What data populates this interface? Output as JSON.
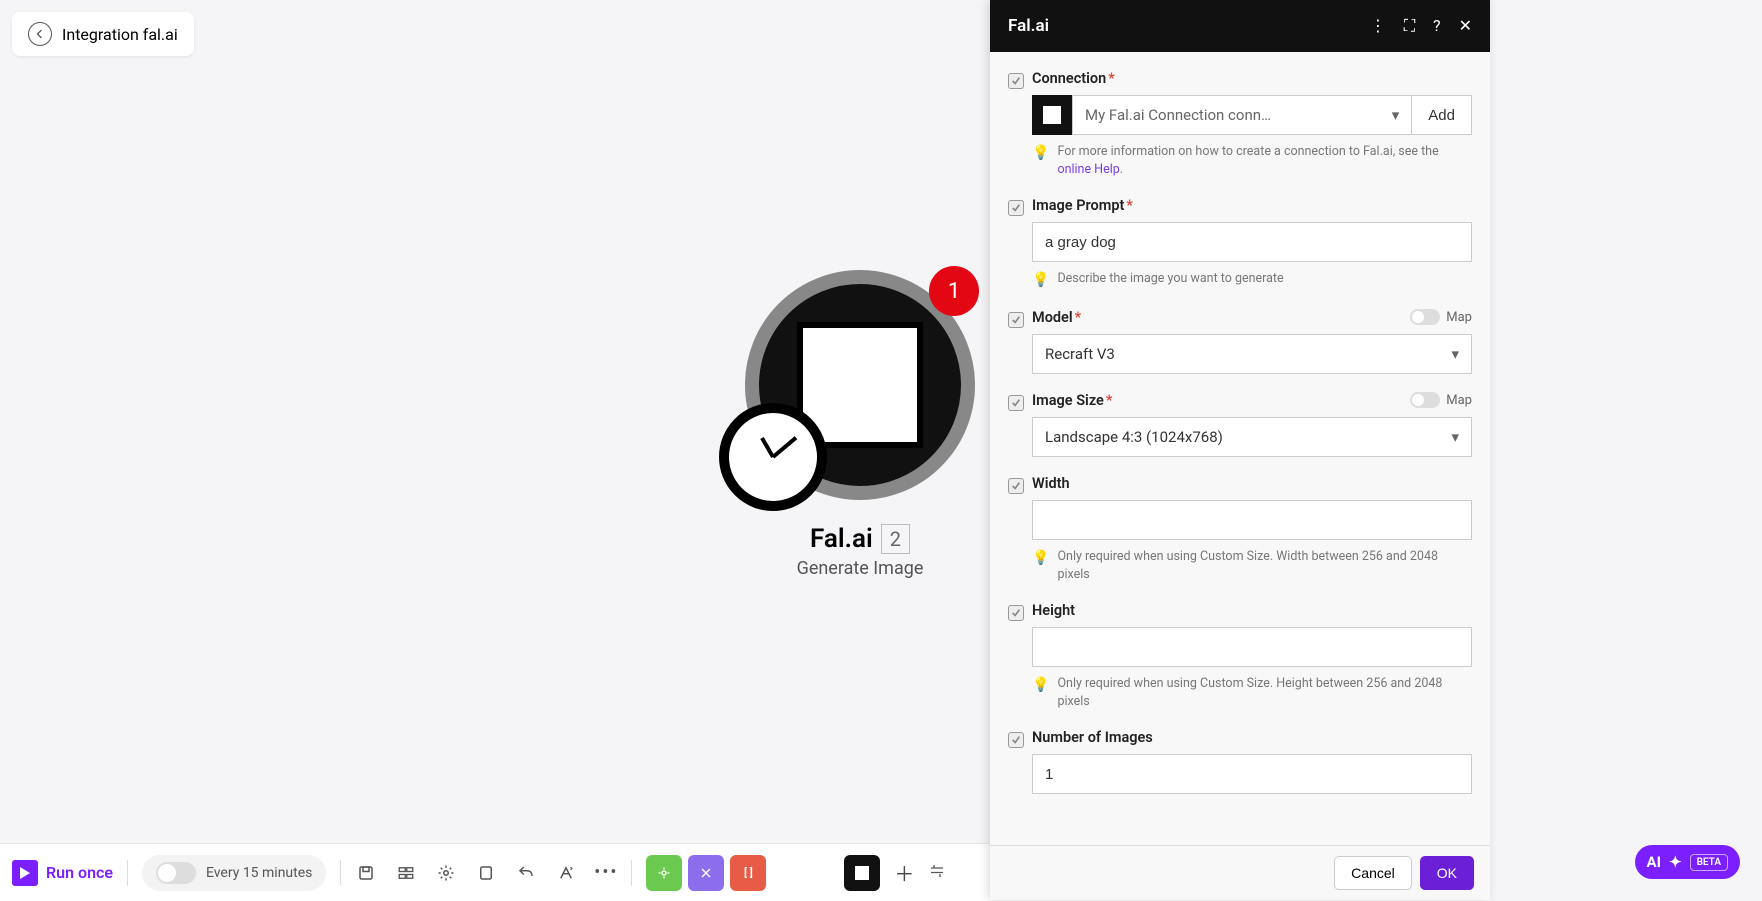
{
  "breadcrumb": {
    "label": "Integration fal.ai"
  },
  "node": {
    "title": "Fal.ai",
    "count": "2",
    "subtitle": "Generate Image",
    "badge": "1"
  },
  "bottomBar": {
    "run_label": "Run once",
    "schedule_label": "Every 15 minutes"
  },
  "panel": {
    "title": "Fal.ai",
    "footer": {
      "cancel": "Cancel",
      "ok": "OK"
    },
    "connection": {
      "label": "Connection",
      "value": "My Fal.ai Connection conn…",
      "add": "Add",
      "hint_prefix": "For more information on how to create a connection to Fal.ai, see the ",
      "hint_link": "online Help",
      "hint_suffix": "."
    },
    "imagePrompt": {
      "label": "Image Prompt",
      "value": "a gray dog",
      "hint": "Describe the image you want to generate"
    },
    "model": {
      "label": "Model",
      "map_label": "Map",
      "value": "Recraft V3"
    },
    "imageSize": {
      "label": "Image Size",
      "map_label": "Map",
      "value": "Landscape 4:3 (1024x768)"
    },
    "width": {
      "label": "Width",
      "value": "",
      "hint": "Only required when using Custom Size. Width between 256 and 2048 pixels"
    },
    "height": {
      "label": "Height",
      "value": "",
      "hint": "Only required when using Custom Size. Height between 256 and 2048 pixels"
    },
    "numImages": {
      "label": "Number of Images",
      "value": "1"
    }
  },
  "aiPill": {
    "label": "AI",
    "beta": "BETA"
  }
}
